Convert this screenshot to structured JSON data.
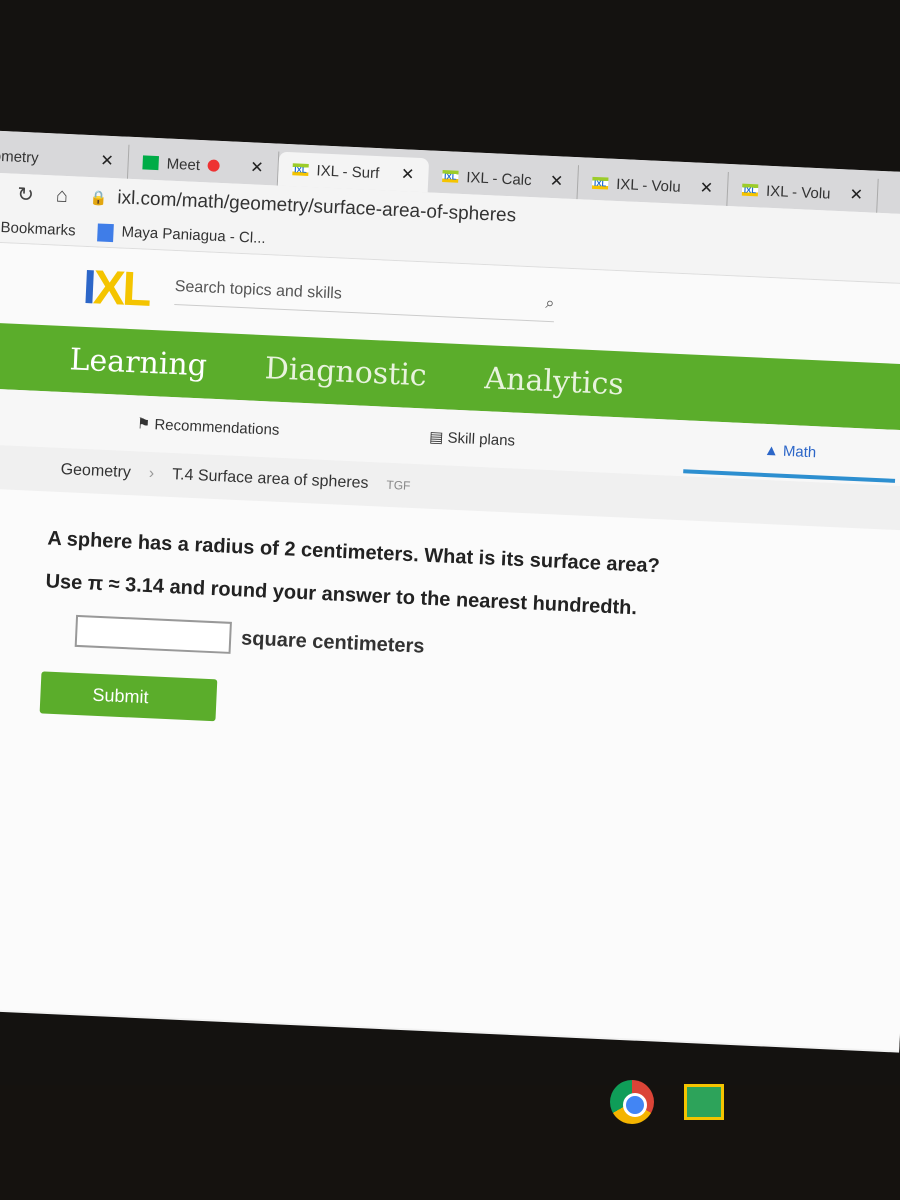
{
  "browser": {
    "tabs": [
      {
        "label": "ometry",
        "icon": "tab-icon",
        "active": false
      },
      {
        "label": "Meet",
        "icon": "meet-icon",
        "recording": true,
        "active": false
      },
      {
        "label": "IXL - Surf",
        "icon": "ixl-icon",
        "active": true
      },
      {
        "label": "IXL - Calc",
        "icon": "ixl-icon",
        "active": false
      },
      {
        "label": "IXL - Volu",
        "icon": "ixl-icon",
        "active": false
      },
      {
        "label": "IXL - Volu",
        "icon": "ixl-icon",
        "active": false
      }
    ],
    "close_glyph": "✕",
    "url": "ixl.com/math/geometry/surface-area-of-spheres",
    "bookmarks": [
      "BC Bookmarks",
      "Maya Paniagua - Cl..."
    ]
  },
  "ixl": {
    "logo": "IXL",
    "search_placeholder": "Search topics and skills",
    "nav": [
      "Learning",
      "Diagnostic",
      "Analytics"
    ],
    "subnav": [
      "Recommendations",
      "Skill plans",
      "Math"
    ],
    "breadcrumb": {
      "subject": "Geometry",
      "skill": "T.4 Surface area of spheres",
      "code": "TGF"
    },
    "question": "A sphere has a radius of 2 centimeters. What is its surface area?",
    "instruction": "Use π ≈ 3.14 and round your answer to the nearest hundredth.",
    "answer_value": "",
    "unit": "square centimeters",
    "submit": "Submit",
    "accent": "#5bad2b"
  },
  "shelf": {
    "icons": [
      "chrome-icon",
      "google-classroom-icon"
    ]
  }
}
